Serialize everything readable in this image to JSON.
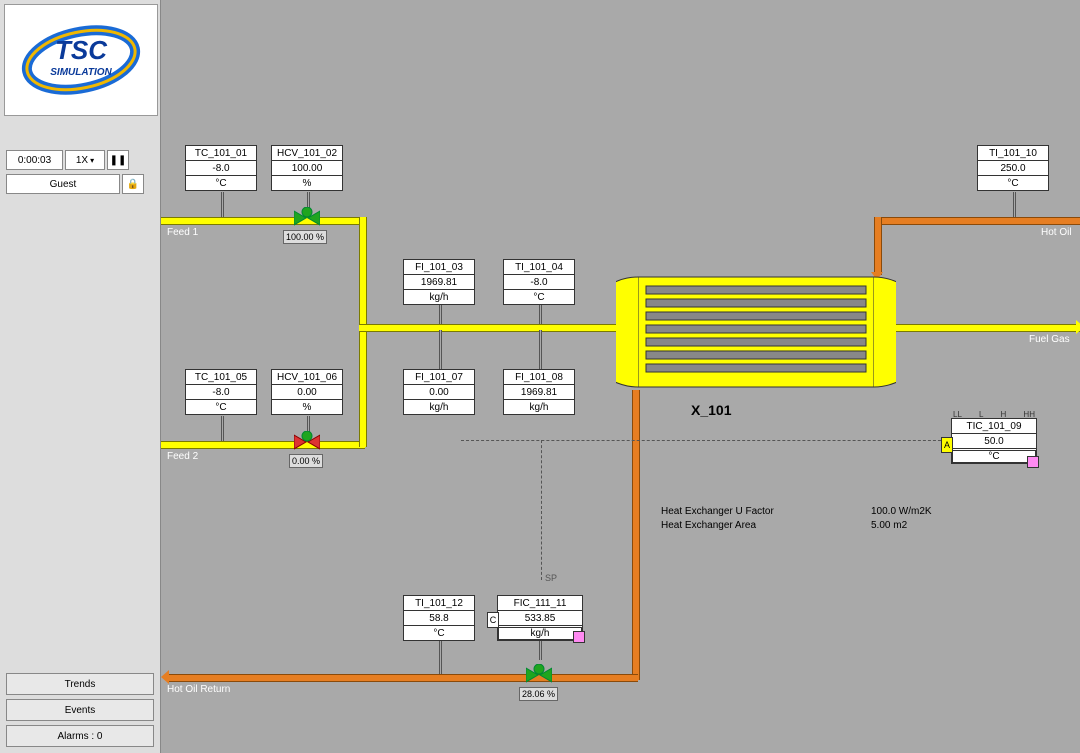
{
  "sidebar": {
    "logo_top": "TSC",
    "logo_bottom": "SIMULATION",
    "time": "0:00:03",
    "speed": "1X",
    "pause": "❚❚",
    "user": "Guest",
    "usericon": "🔒",
    "btn_trends": "Trends",
    "btn_events": "Events",
    "btn_alarms": "Alarms : 0"
  },
  "labels": {
    "feed1": "Feed 1",
    "feed2": "Feed 2",
    "hotoil": "Hot Oil",
    "fuelgas": "Fuel Gas",
    "hotret": "Hot Oil Return",
    "hxname": "X_101",
    "sp": "SP",
    "hxU_label": "Heat Exchanger U Factor",
    "hxU_val": "100.0 W/m2K",
    "hxA_label": "Heat Exchanger Area",
    "hxA_val": "5.00 m2",
    "alarm_LL": "LL",
    "alarm_L": "L",
    "alarm_H": "H",
    "alarm_HH": "HH",
    "A": "A",
    "C": "C"
  },
  "tags": {
    "TC_101_01": {
      "name": "TC_101_01",
      "val": "-8.0",
      "unit": "°C"
    },
    "HCV_101_02": {
      "name": "HCV_101_02",
      "val": "100.00",
      "unit": "%"
    },
    "FI_101_03": {
      "name": "FI_101_03",
      "val": "1969.81",
      "unit": "kg/h"
    },
    "TI_101_04": {
      "name": "TI_101_04",
      "val": "-8.0",
      "unit": "°C"
    },
    "TC_101_05": {
      "name": "TC_101_05",
      "val": "-8.0",
      "unit": "°C"
    },
    "HCV_101_06": {
      "name": "HCV_101_06",
      "val": "0.00",
      "unit": "%"
    },
    "FI_101_07": {
      "name": "FI_101_07",
      "val": "0.00",
      "unit": "kg/h"
    },
    "FI_101_08": {
      "name": "FI_101_08",
      "val": "1969.81",
      "unit": "kg/h"
    },
    "TI_101_10": {
      "name": "TI_101_10",
      "val": "250.0",
      "unit": "°C"
    },
    "TI_101_12": {
      "name": "TI_101_12",
      "val": "58.8",
      "unit": "°C"
    },
    "TIC_101_09": {
      "name": "TIC_101_09",
      "val": "50.0",
      "unit": "°C"
    },
    "FIC_111_11": {
      "name": "FIC_111_11",
      "val": "533.85",
      "unit": "kg/h"
    }
  },
  "valves": {
    "v1": "100.00 %",
    "v2": "0.00 %",
    "v3": "28.06 %"
  }
}
